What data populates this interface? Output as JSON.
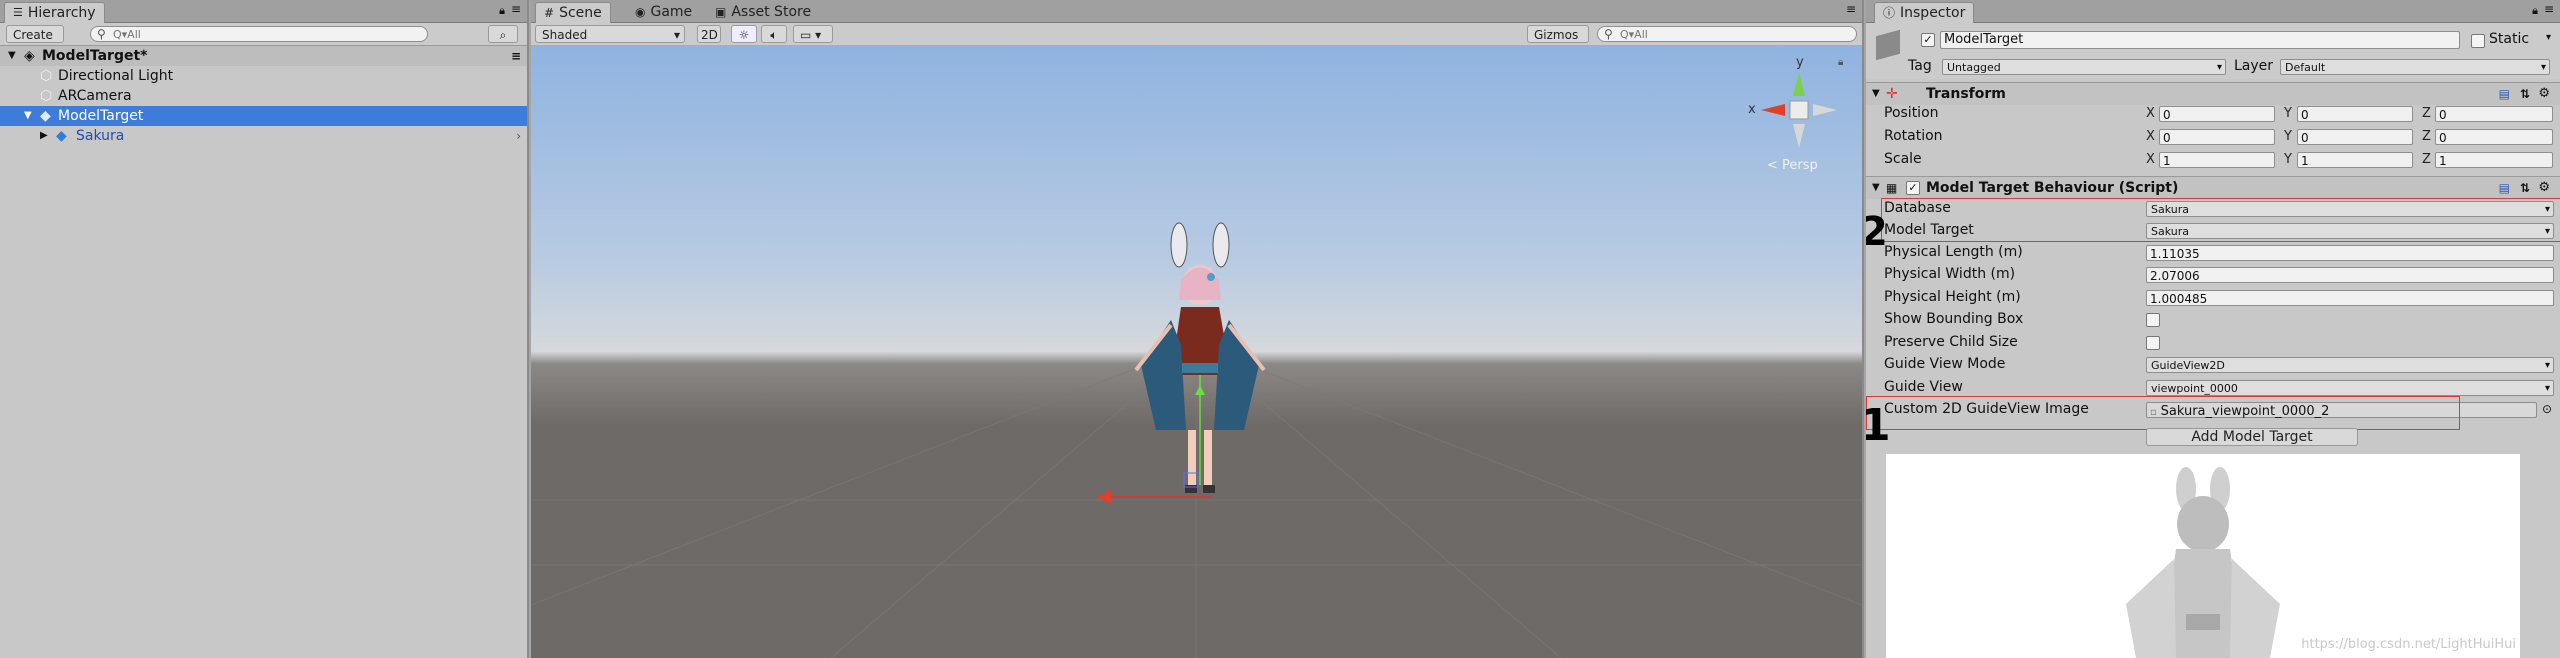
{
  "hierarchy": {
    "tab_label": "Hierarchy",
    "create_label": "Create",
    "search_placeholder": "Q▾All",
    "scene_name": "ModelTarget*",
    "items": [
      {
        "label": "Directional Light"
      },
      {
        "label": "ARCamera"
      },
      {
        "label": "ModelTarget"
      },
      {
        "label": "Sakura"
      }
    ]
  },
  "scene": {
    "tabs": [
      {
        "label": "Scene"
      },
      {
        "label": "Game"
      },
      {
        "label": "Asset Store"
      }
    ],
    "shading_mode": "Shaded",
    "mode_2d": "2D",
    "gizmos_label": "Gizmos",
    "search_placeholder": "Q▾All",
    "persp_label": "< Persp",
    "gizmo_x": "x",
    "gizmo_y": "y",
    "colors": {
      "sky_top": "#8fb3e0",
      "horizon": "#d6d8dc",
      "ground": "#6e6a67"
    }
  },
  "inspector": {
    "tab_label": "Inspector",
    "object_name": "ModelTarget",
    "static_label": "Static",
    "tag_label": "Tag",
    "tag_value": "Untagged",
    "layer_label": "Layer",
    "layer_value": "Default",
    "transform": {
      "title": "Transform",
      "position": {
        "label": "Position",
        "x": "0",
        "y": "0",
        "z": "0"
      },
      "rotation": {
        "label": "Rotation",
        "x": "0",
        "y": "0",
        "z": "0"
      },
      "scale": {
        "label": "Scale",
        "x": "1",
        "y": "1",
        "z": "1"
      }
    },
    "script": {
      "title": "Model Target Behaviour (Script)",
      "database_label": "Database",
      "database_value": "Sakura",
      "model_target_label": "Model Target",
      "model_target_value": "Sakura",
      "physical_length_label": "Physical Length (m)",
      "physical_length_value": "1.11035",
      "physical_width_label": "Physical Width (m)",
      "physical_width_value": "2.07006",
      "physical_height_label": "Physical Height (m)",
      "physical_height_value": "1.000485",
      "show_bbox_label": "Show Bounding Box",
      "preserve_child_label": "Preserve Child Size",
      "guide_view_mode_label": "Guide View Mode",
      "guide_view_mode_value": "GuideView2D",
      "guide_view_label": "Guide View",
      "guide_view_value": "viewpoint_0000",
      "custom_image_label": "Custom 2D GuideView Image",
      "custom_image_value": "Sakura_viewpoint_0000_2",
      "add_button_label": "Add Model Target"
    },
    "annotation_1": "1",
    "annotation_2": "2",
    "watermark": "https://blog.csdn.net/LightHuiHui"
  }
}
